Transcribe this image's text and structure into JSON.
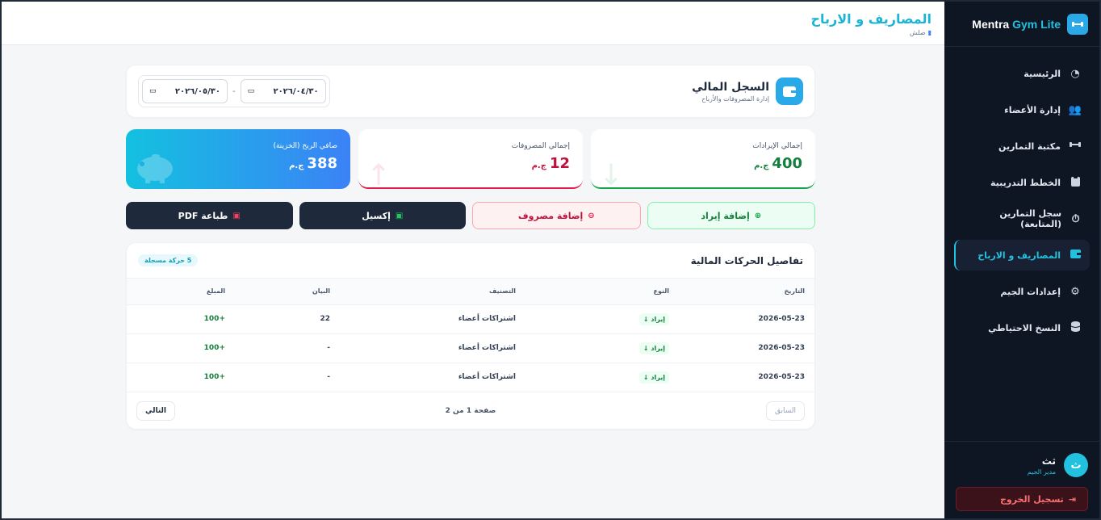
{
  "brand": {
    "name_part1": "Mentra",
    "name_part2": "Gym Lite"
  },
  "sidebar": {
    "items": [
      {
        "label": "الرئيسية",
        "icon": "chart-pie-icon"
      },
      {
        "label": "إدارة الأعضاء",
        "icon": "users-icon"
      },
      {
        "label": "مكتبة التمارين",
        "icon": "dumbbell-icon"
      },
      {
        "label": "الخطط التدريبية",
        "icon": "clipboard-icon"
      },
      {
        "label": "سجل التمارين (المتابعة)",
        "icon": "stopwatch-icon"
      },
      {
        "label": "المصاريف و الارباح",
        "icon": "wallet-icon",
        "active": true
      },
      {
        "label": "إعدادات الجيم",
        "icon": "gear-icon"
      },
      {
        "label": "النسخ الاحتياطي",
        "icon": "database-icon"
      }
    ]
  },
  "user": {
    "initial": "ث",
    "name": "ثث",
    "role": "مدير الجيم",
    "logout_label": "تسجيل الخروج"
  },
  "header": {
    "title": "المصاريف و الارباح",
    "breadcrumb": "صلش"
  },
  "ledger": {
    "title": "السجل المالي",
    "subtitle": "إدارة المصروفات والأرباح",
    "date_from": "٢٠٢٦/٠٤/٣٠",
    "date_to": "٢٠٢٦/٠٥/٣٠",
    "date_separator": "-"
  },
  "stats": {
    "income": {
      "label": "إجمالي الإيرادات",
      "value": "400",
      "currency": "ج.م"
    },
    "expense": {
      "label": "إجمالي المصروفات",
      "value": "12",
      "currency": "ج.م"
    },
    "net": {
      "label": "صافي الربح (الخزينة)",
      "value": "388",
      "currency": "ج.م"
    }
  },
  "actions": {
    "add_income": "إضافة إيراد",
    "add_expense": "إضافة مصروف",
    "excel": "إكسيل",
    "print_pdf": "طباعة PDF"
  },
  "transactions": {
    "title": "تفاصيل الحركات المالية",
    "count_badge": "5 حركة مسجلة",
    "columns": {
      "date": "التاريخ",
      "type": "النوع",
      "category": "التصنيف",
      "description": "البيان",
      "amount": "المبلغ"
    },
    "rows": [
      {
        "date": "2026-05-23",
        "type": "إيراد",
        "category": "اشتراكات أعضاء",
        "description": "22",
        "amount": "+100"
      },
      {
        "date": "2026-05-23",
        "type": "إيراد",
        "category": "اشتراكات أعضاء",
        "description": "-",
        "amount": "+100"
      },
      {
        "date": "2026-05-23",
        "type": "إيراد",
        "category": "اشتراكات أعضاء",
        "description": "-",
        "amount": "+100"
      }
    ],
    "pagination": {
      "prev": "السابق",
      "info": "صفحة 1 من 2",
      "next": "التالي"
    }
  },
  "colors": {
    "accent": "#22c1e0",
    "income": "#15803d",
    "expense": "#be123c",
    "sidebar_bg": "#0f1623"
  }
}
